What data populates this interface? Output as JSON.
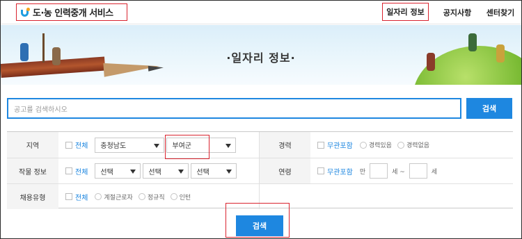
{
  "header": {
    "logo_text": "도·농 인력중개 서비스",
    "nav": [
      "일자리 정보",
      "공지사항",
      "센터찾기"
    ]
  },
  "banner": {
    "title": "·일자리 정보·"
  },
  "search": {
    "placeholder": "공고를 검색하시오",
    "button": "검색"
  },
  "filters": {
    "region": {
      "label": "지역",
      "all": "전체",
      "province": "충청남도",
      "county": "부여군"
    },
    "crop": {
      "label": "작물 정보",
      "all": "전체",
      "selects": [
        "선택",
        "선택",
        "선택"
      ]
    },
    "employment": {
      "label": "채용유형",
      "all": "전체",
      "options": [
        "계절근로자",
        "정규직",
        "인턴"
      ]
    },
    "experience": {
      "label": "경력",
      "any": "무관포함",
      "options": [
        "경력있음",
        "경력없음"
      ]
    },
    "age": {
      "label": "연령",
      "any": "무관포함",
      "prefix": "만",
      "mid": "세 ~",
      "suffix": "세"
    }
  },
  "submit": {
    "label": "검색"
  },
  "colors": {
    "accent": "#1e87e0",
    "highlight": "#d9232e"
  }
}
